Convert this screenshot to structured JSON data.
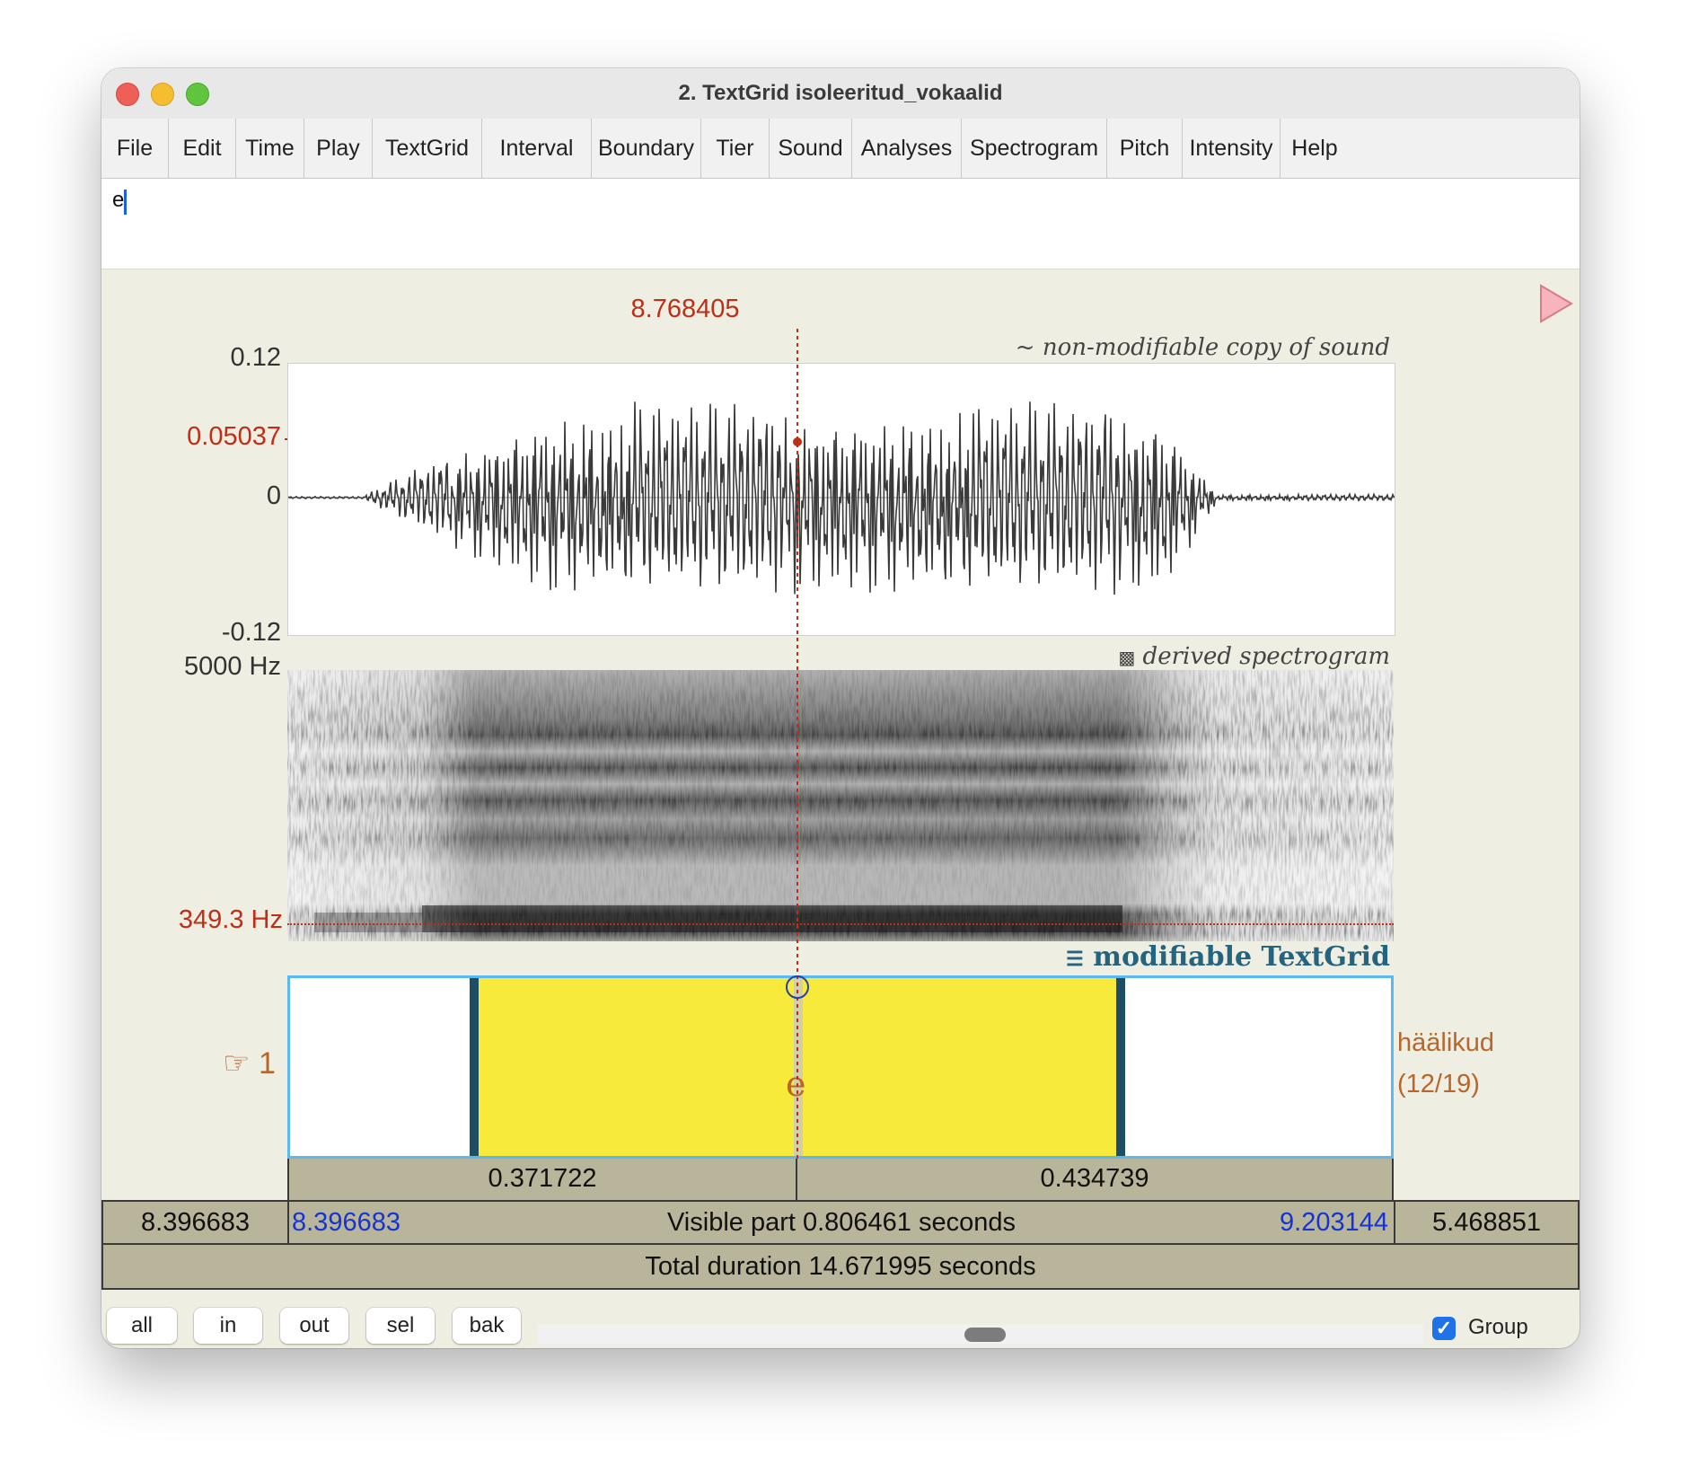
{
  "window": {
    "title": "2. TextGrid isoleeritud_vokaalid"
  },
  "menu": [
    "File",
    "Edit",
    "Time",
    "Play",
    "TextGrid",
    "Interval",
    "Boundary",
    "Tier",
    "Sound",
    "Analyses",
    "Spectrogram",
    "Pitch",
    "Intensity",
    "Help"
  ],
  "text_field": {
    "value": "e"
  },
  "cursor_time": "8.768405",
  "waveform": {
    "title": "non-modifiable copy of sound",
    "title_symbol": "~",
    "y_max": "0.12",
    "y_zero": "0",
    "y_min": "-0.12",
    "cursor_value": "0.05037"
  },
  "spectrogram": {
    "title": "derived spectrogram",
    "title_symbol": "▩",
    "freq_max": "5000 Hz",
    "cursor_freq": "349.3 Hz"
  },
  "textgrid": {
    "title": "modifiable TextGrid",
    "title_symbol": "☰",
    "tier_number": "1",
    "tier_pointer": "☞",
    "tier_name": "häälikud",
    "tier_count": "(12/19)",
    "interval_label": "e"
  },
  "durations": {
    "left_part": "0.371722",
    "right_part": "0.434739"
  },
  "time_bar": {
    "window_start": "8.396683",
    "visible_start": "8.396683",
    "visible_label": "Visible part 0.806461 seconds",
    "visible_end": "9.203144",
    "remaining": "5.468851"
  },
  "total_bar": "Total duration 14.671995 seconds",
  "buttons": [
    "all",
    "in",
    "out",
    "sel",
    "bak"
  ],
  "group": {
    "label": "Group",
    "checked": true
  },
  "colors": {
    "background": "#efeee2",
    "interval_fill": "#f7ea3a",
    "tier_border": "#5bb9ef",
    "cursor": "#c12d15",
    "bar": "#b8b59a",
    "blue_time": "#1534d6"
  }
}
